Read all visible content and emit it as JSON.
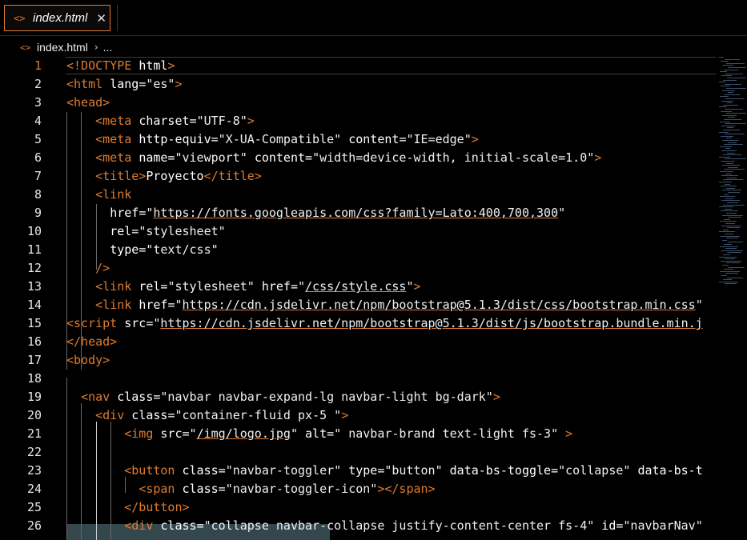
{
  "tab": {
    "icon": "<>",
    "label": "index.html",
    "close": "✕"
  },
  "breadcrumb": {
    "icon": "<>",
    "file": "index.html",
    "chevron": "›",
    "more": "..."
  },
  "current_line": 1,
  "lines": [
    {
      "n": "1",
      "tokens": [
        [
          "tg",
          "<!DOCTYPE "
        ],
        [
          "at",
          "html"
        ],
        [
          "tg",
          ">"
        ]
      ]
    },
    {
      "n": "2",
      "tokens": [
        [
          "tg",
          "<html "
        ],
        [
          "at",
          "lang"
        ],
        [
          "tx",
          "="
        ],
        [
          "st",
          "\"es\""
        ],
        [
          "tg",
          ">"
        ]
      ]
    },
    {
      "n": "3",
      "tokens": [
        [
          "tg",
          "<head>"
        ]
      ]
    },
    {
      "n": "4",
      "indent": "    ",
      "tokens": [
        [
          "tg",
          "<meta "
        ],
        [
          "at",
          "charset"
        ],
        [
          "tx",
          "="
        ],
        [
          "st",
          "\"UTF-8\""
        ],
        [
          "tg",
          ">"
        ]
      ]
    },
    {
      "n": "5",
      "indent": "    ",
      "tokens": [
        [
          "tg",
          "<meta "
        ],
        [
          "at",
          "http-equiv"
        ],
        [
          "tx",
          "="
        ],
        [
          "st",
          "\"X-UA-Compatible\""
        ],
        [
          "tx",
          " "
        ],
        [
          "at",
          "content"
        ],
        [
          "tx",
          "="
        ],
        [
          "st",
          "\"IE=edge\""
        ],
        [
          "tg",
          ">"
        ]
      ]
    },
    {
      "n": "6",
      "indent": "    ",
      "tokens": [
        [
          "tg",
          "<meta "
        ],
        [
          "at",
          "name"
        ],
        [
          "tx",
          "="
        ],
        [
          "st",
          "\"viewport\""
        ],
        [
          "tx",
          " "
        ],
        [
          "at",
          "content"
        ],
        [
          "tx",
          "="
        ],
        [
          "st",
          "\"width=device-width, initial-scale=1.0\""
        ],
        [
          "tg",
          ">"
        ]
      ]
    },
    {
      "n": "7",
      "indent": "    ",
      "tokens": [
        [
          "tg",
          "<title>"
        ],
        [
          "tx",
          "Proyecto"
        ],
        [
          "tg",
          "</title>"
        ]
      ]
    },
    {
      "n": "8",
      "indent": "    ",
      "tokens": [
        [
          "tg",
          "<link"
        ]
      ]
    },
    {
      "n": "9",
      "indent": "      ",
      "tokens": [
        [
          "at",
          "href"
        ],
        [
          "tx",
          "="
        ],
        [
          "st",
          "\""
        ],
        [
          "lk",
          "https://fonts.googleapis.com/css?family=Lato:400,700,300"
        ],
        [
          "st",
          "\""
        ]
      ]
    },
    {
      "n": "10",
      "indent": "      ",
      "tokens": [
        [
          "at",
          "rel"
        ],
        [
          "tx",
          "="
        ],
        [
          "st",
          "\"stylesheet\""
        ]
      ]
    },
    {
      "n": "11",
      "indent": "      ",
      "tokens": [
        [
          "at",
          "type"
        ],
        [
          "tx",
          "="
        ],
        [
          "st",
          "\"text/css\""
        ]
      ]
    },
    {
      "n": "12",
      "indent": "    ",
      "tokens": [
        [
          "tg",
          "/>"
        ]
      ]
    },
    {
      "n": "13",
      "indent": "    ",
      "tokens": [
        [
          "tg",
          "<link "
        ],
        [
          "at",
          "rel"
        ],
        [
          "tx",
          "="
        ],
        [
          "st",
          "\"stylesheet\""
        ],
        [
          "tx",
          " "
        ],
        [
          "at",
          "href"
        ],
        [
          "tx",
          "="
        ],
        [
          "st",
          "\""
        ],
        [
          "lk",
          "/css/style.css"
        ],
        [
          "st",
          "\""
        ],
        [
          "tg",
          ">"
        ]
      ]
    },
    {
      "n": "14",
      "indent": "    ",
      "tokens": [
        [
          "tg",
          "<link "
        ],
        [
          "at",
          "href"
        ],
        [
          "tx",
          "="
        ],
        [
          "st",
          "\""
        ],
        [
          "lk",
          "https://cdn.jsdelivr.net/npm/bootstrap@5.1.3/dist/css/bootstrap.min.css"
        ],
        [
          "st",
          "\""
        ]
      ]
    },
    {
      "n": "15",
      "tokens": [
        [
          "tg",
          "<script "
        ],
        [
          "at",
          "src"
        ],
        [
          "tx",
          "="
        ],
        [
          "st",
          "\""
        ],
        [
          "lk",
          "https://cdn.jsdelivr.net/npm/bootstrap@5.1.3/dist/js/bootstrap.bundle.min.j"
        ]
      ]
    },
    {
      "n": "16",
      "tokens": [
        [
          "tg",
          "</head>"
        ]
      ]
    },
    {
      "n": "17",
      "tokens": [
        [
          "tg",
          "<body>"
        ]
      ]
    },
    {
      "n": "18",
      "tokens": []
    },
    {
      "n": "19",
      "indent": "  ",
      "tokens": [
        [
          "tg",
          "<nav "
        ],
        [
          "at",
          "class"
        ],
        [
          "tx",
          "="
        ],
        [
          "st",
          "\"navbar navbar-expand-lg navbar-light bg-dark\""
        ],
        [
          "tg",
          ">"
        ]
      ]
    },
    {
      "n": "20",
      "indent": "    ",
      "tokens": [
        [
          "tg",
          "<div "
        ],
        [
          "at",
          "class"
        ],
        [
          "tx",
          "="
        ],
        [
          "st",
          "\"container-fluid px-5 \""
        ],
        [
          "tg",
          ">"
        ]
      ]
    },
    {
      "n": "21",
      "indent": "        ",
      "tokens": [
        [
          "tg",
          "<img "
        ],
        [
          "at",
          "src"
        ],
        [
          "tx",
          "="
        ],
        [
          "st",
          "\""
        ],
        [
          "lk",
          "/img/logo.jpg"
        ],
        [
          "st",
          "\""
        ],
        [
          "tx",
          " "
        ],
        [
          "at",
          "alt"
        ],
        [
          "tx",
          "="
        ],
        [
          "st",
          "\" navbar-brand text-light fs-3\""
        ],
        [
          "tx",
          " "
        ],
        [
          "tg",
          ">"
        ]
      ]
    },
    {
      "n": "22",
      "tokens": []
    },
    {
      "n": "23",
      "indent": "        ",
      "tokens": [
        [
          "tg",
          "<button "
        ],
        [
          "at",
          "class"
        ],
        [
          "tx",
          "="
        ],
        [
          "st",
          "\"navbar-toggler\""
        ],
        [
          "tx",
          " "
        ],
        [
          "at",
          "type"
        ],
        [
          "tx",
          "="
        ],
        [
          "st",
          "\"button\""
        ],
        [
          "tx",
          " "
        ],
        [
          "at",
          "data-bs-toggle"
        ],
        [
          "tx",
          "="
        ],
        [
          "st",
          "\"collapse\""
        ],
        [
          "tx",
          " "
        ],
        [
          "at",
          "data-bs-t"
        ]
      ]
    },
    {
      "n": "24",
      "indent": "          ",
      "tokens": [
        [
          "tg",
          "<span "
        ],
        [
          "at",
          "class"
        ],
        [
          "tx",
          "="
        ],
        [
          "st",
          "\"navbar-toggler-icon\""
        ],
        [
          "tg",
          "></span>"
        ]
      ]
    },
    {
      "n": "25",
      "indent": "        ",
      "tokens": [
        [
          "tg",
          "</button>"
        ]
      ]
    },
    {
      "n": "26",
      "indent": "        ",
      "tokens": [
        [
          "tg",
          "<div "
        ],
        [
          "at",
          "class"
        ],
        [
          "tx",
          "="
        ],
        [
          "st",
          "\"collapse navbar-collapse justify-content-center fs-4\""
        ],
        [
          "tx",
          " "
        ],
        [
          "at",
          "id"
        ],
        [
          "tx",
          "="
        ],
        [
          "st",
          "\"navbarNav\""
        ]
      ]
    }
  ]
}
